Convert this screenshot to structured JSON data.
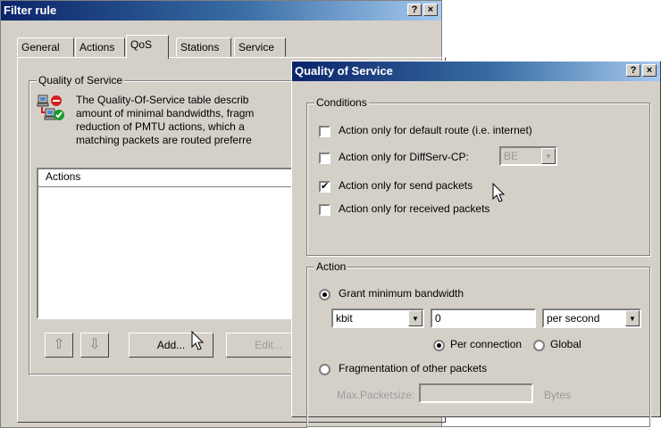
{
  "filter_dialog": {
    "title": "Filter rule",
    "help_btn": "?",
    "close_btn": "×",
    "tabs": [
      "General",
      "Actions",
      "QoS",
      "Stations",
      "Service"
    ],
    "group_label": "Quality of Service",
    "description": [
      "The Quality-Of-Service table describ",
      "amount of minimal bandwidths, fragm",
      "reduction of PMTU actions, which a",
      "matching packets are routed preferre"
    ],
    "list_header": "Actions",
    "btn_up": "⇧",
    "btn_down": "⇩",
    "btn_add": "Add...",
    "btn_edit": "Edit..."
  },
  "qos_dialog": {
    "title": "Quality of Service",
    "help_btn": "?",
    "close_btn": "×",
    "conditions_label": "Conditions",
    "conditions": [
      {
        "label": "Action only for default route (i.e. internet)",
        "checked": false
      },
      {
        "label": "Action only for DiffServ-CP:",
        "checked": false
      },
      {
        "label": "Action only for send packets",
        "checked": true
      },
      {
        "label": "Action only for received packets",
        "checked": false
      }
    ],
    "diffserv_value": "BE",
    "action_label": "Action",
    "grant_label": "Grant minimum bandwidth",
    "unit_value": "kbit",
    "bandwidth_value": "0",
    "period_value": "per second",
    "per_connection_label": "Per connection",
    "global_label": "Global",
    "fragmentation_label": "Fragmentation of other packets",
    "max_packetsize_label": "Max.Packetsize:",
    "bytes_label": "Bytes"
  },
  "colors": {
    "dialog_bg": "#d4d0c8",
    "title_start": "#0a246a",
    "title_end": "#a6caf0"
  }
}
